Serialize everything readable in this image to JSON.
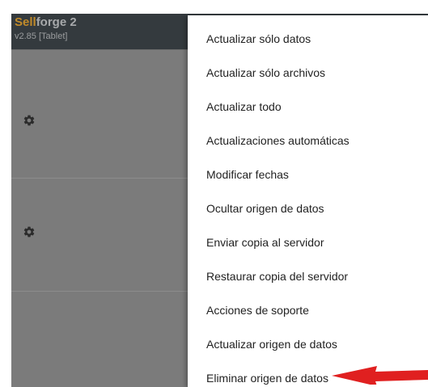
{
  "app": {
    "title_accent": "Sell",
    "title_rest": "forge 2",
    "version": "v2.85 [Tablet]"
  },
  "colors": {
    "header_bg": "#343a3e",
    "title_accent": "#c08a2a",
    "panel_bg": "#7b7b7b",
    "arrow": "#e02020"
  },
  "sections": [
    {
      "icon": "gear-icon"
    },
    {
      "icon": "gear-icon"
    }
  ],
  "menu": {
    "items": [
      {
        "label": "Actualizar sólo datos"
      },
      {
        "label": "Actualizar sólo archivos"
      },
      {
        "label": "Actualizar todo"
      },
      {
        "label": "Actualizaciones automáticas"
      },
      {
        "label": "Modificar fechas"
      },
      {
        "label": "Ocultar origen de datos"
      },
      {
        "label": "Enviar copia al servidor"
      },
      {
        "label": "Restaurar copia del servidor"
      },
      {
        "label": "Acciones de soporte"
      },
      {
        "label": "Actualizar origen de datos"
      },
      {
        "label": "Eliminar origen de datos"
      }
    ]
  },
  "annotation": {
    "icon": "red-arrow-icon"
  }
}
